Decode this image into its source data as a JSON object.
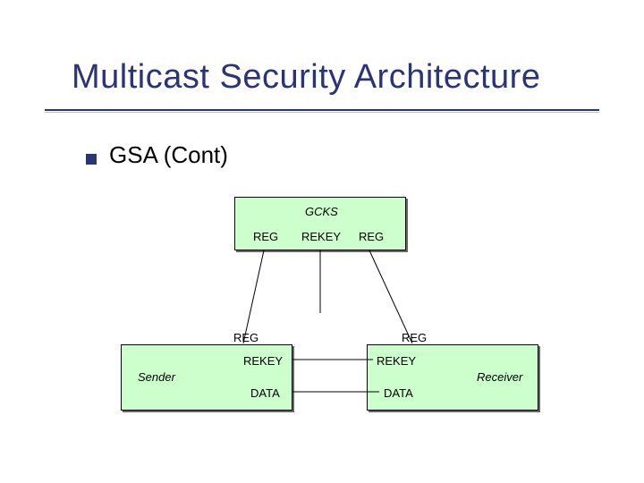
{
  "title": "Multicast Security Architecture",
  "bullet": "GSA (Cont)",
  "diagram": {
    "gcks": "GCKS",
    "gcks_left": "REG",
    "gcks_mid": "REKEY",
    "gcks_right": "REG",
    "sender_top": "REG",
    "sender_label": "Sender",
    "sender_rekey": "REKEY",
    "sender_data": "DATA",
    "receiver_top": "REG",
    "receiver_label": "Receiver",
    "receiver_rekey": "REKEY",
    "receiver_data": "DATA"
  }
}
